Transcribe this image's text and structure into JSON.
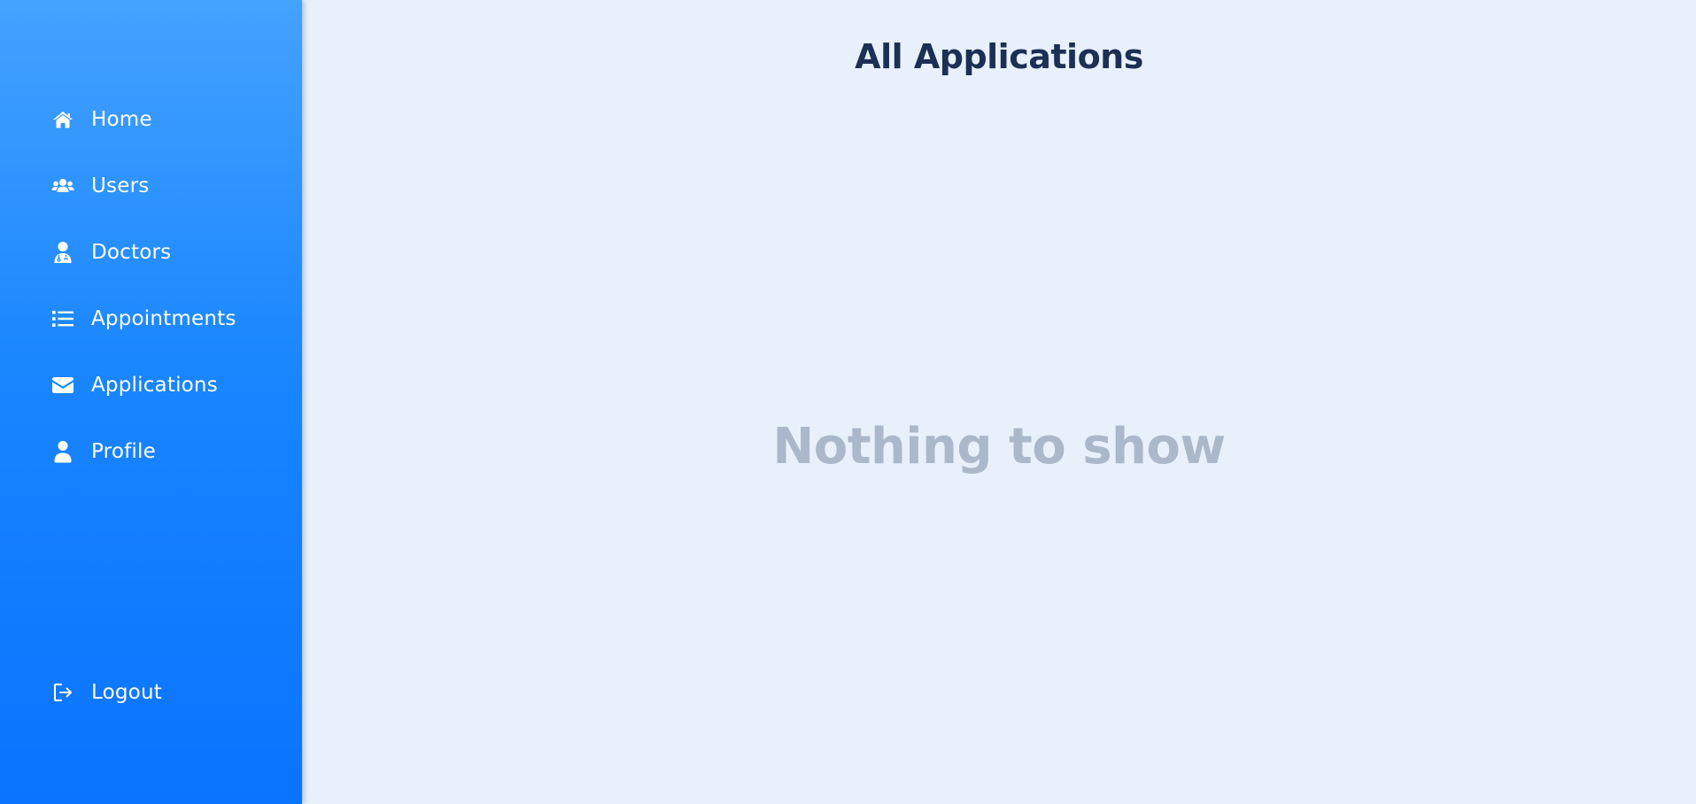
{
  "sidebar": {
    "items": [
      {
        "label": "Home",
        "icon": "home-icon"
      },
      {
        "label": "Users",
        "icon": "users-icon"
      },
      {
        "label": "Doctors",
        "icon": "doctor-icon"
      },
      {
        "label": "Appointments",
        "icon": "list-icon"
      },
      {
        "label": "Applications",
        "icon": "envelope-icon"
      },
      {
        "label": "Profile",
        "icon": "user-icon"
      }
    ],
    "logout": {
      "label": "Logout",
      "icon": "logout-icon"
    }
  },
  "main": {
    "title": "All Applications",
    "empty_message": "Nothing to show"
  },
  "colors": {
    "sidebar_top": "#44a2ff",
    "sidebar_bottom": "#0a73ff",
    "background": "#e8f1fb",
    "title": "#1c2f55",
    "empty_text": "#abb8c9"
  }
}
